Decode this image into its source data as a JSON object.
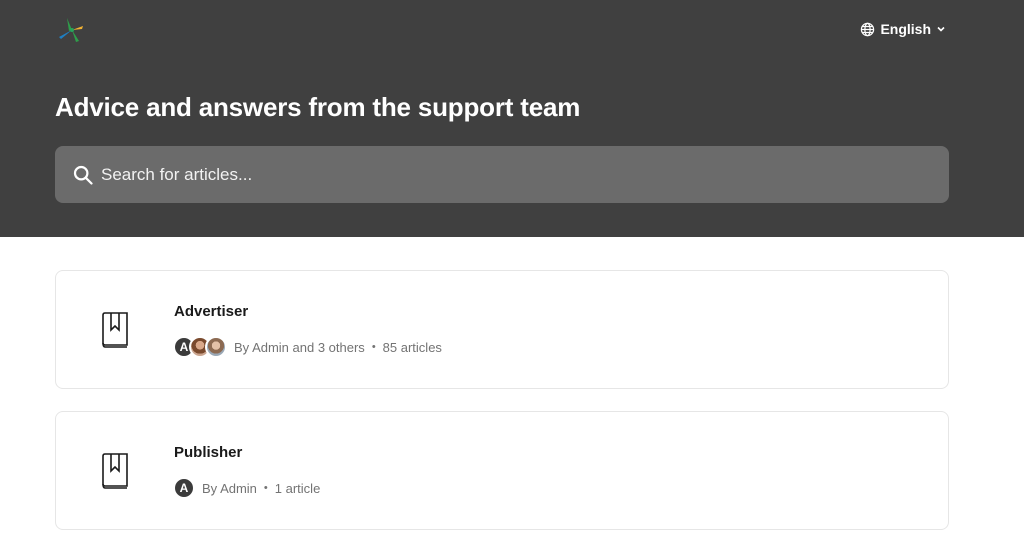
{
  "header": {
    "language": "English",
    "title": "Advice and answers from the support team",
    "search_placeholder": "Search for articles..."
  },
  "collections": [
    {
      "title": "Advertiser",
      "authors": "By Admin and 3 others",
      "count": "85 articles",
      "avatar_letter": "A"
    },
    {
      "title": "Publisher",
      "authors": "By Admin",
      "count": "1 article",
      "avatar_letter": "A"
    }
  ],
  "icons": {
    "logo": "logo-icon",
    "language": "globe-icon",
    "dropdown": "chevron-down-icon",
    "search": "search-icon",
    "collection": "book-bookmark-icon"
  },
  "colors": {
    "header_bg": "#404040",
    "search_bg": "#6b6b6b",
    "card_border": "#e6e6e6",
    "text_primary": "#1a1a1a",
    "text_muted": "#737373"
  }
}
